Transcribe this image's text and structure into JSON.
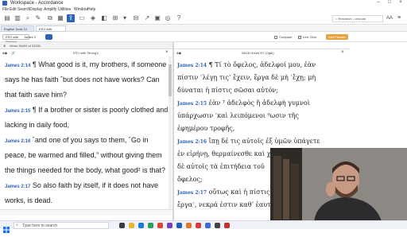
{
  "window": {
    "title": "Workspace - Accordance",
    "min": "–",
    "max": "□",
    "close": "×"
  },
  "menu": [
    "File",
    "Edit",
    "Search",
    "Display",
    "Amplify",
    "Utilities",
    "Window",
    "Help"
  ],
  "toolbar": {
    "search_placeholder": "○ Research - unicode"
  },
  "tabs": [
    {
      "label": "English Tools ",
      "count": "12"
    },
    {
      "label": "ESV with Strong's"
    }
  ],
  "subbar": {
    "left_pill": "ESV with Strong's",
    "hint": "Verse 30429 of 31031",
    "compare": "Compare",
    "live_click": "Live Click",
    "add_parallel": "Add Parallel"
  },
  "left_pane": {
    "title": "ESV with Strong's",
    "lines": [
      {
        "ref": "James 2:14",
        "text": " ¶ What good is it, my brothers, if someone"
      },
      {
        "text": "says he has faith ˹but does not have works? Can"
      },
      {
        "text": "that faith save him?"
      },
      {
        "ref": "James 2:15",
        "text": " ¶ If a brother or sister is poorly clothed and"
      },
      {
        "text": "lacking in daily food,"
      },
      {
        "ref": "James 2:16",
        "text": " ˹and one of you says to them, ˹Go in"
      },
      {
        "text": "peace, be warmed and filled,” without giving them"
      },
      {
        "text": "the things needed for the body, what good² is that?"
      },
      {
        "ref": "James 2:17",
        "text": " So also faith by itself, if it does not have"
      },
      {
        "text": "works, is dead."
      }
    ]
  },
  "right_pane": {
    "title": "NA28 Greek NT (Ogtk)",
    "lines": [
      {
        "ref": "James 2:14",
        "text": " ¶  Τί  τὸ ὄφελος, ἀδελφοί μου, ἐὰν"
      },
      {
        "text": "πίστιν ˹λέγῃ τις˺ ἔχειν, ἔργα δὲ μὴ ˹ἔχῃ; μὴ"
      },
      {
        "text": "δύναται ἡ πίστις σῶσαι αὐτόν;"
      },
      {
        "ref": "James 2:15",
        "text": " ἐὰν  ᵀ ἀδελφὸς ἢ ἀδελφὴ γυμνοὶ"
      },
      {
        "text": "ὑπάρχωσιν  ˹καὶ λειπόμενοι  ⁰ωσιν τῆς"
      },
      {
        "text": "ἐφημέρου τροφῆς,"
      },
      {
        "ref": "James 2:16",
        "text": " ἴπῃ δέ τις αὐτοῖς ἐξ ὑμῶν ὑπάγετε"
      },
      {
        "text": "ἐν εἰρήνῃ, θερμαίνεσθε καὶ χορτάζεσθε,"
      },
      {
        "text": "δὲ αὐτοῖς τὰ ἐπιτήδεια τοῦ"
      },
      {
        "text": "ὄφελος;"
      },
      {
        "ref": "James 2:17",
        "text": " οὕτως καὶ ἡ πίστις"
      },
      {
        "text": "ἔργα˺, νεκρά ἐστιν καθʼ ἑαυτήν."
      }
    ]
  },
  "taskbar": {
    "search_text": "Type here to search"
  },
  "colors": {
    "accent": "#2f63b8",
    "ref": "#2f63b8",
    "add_button": "#e9a23b"
  }
}
